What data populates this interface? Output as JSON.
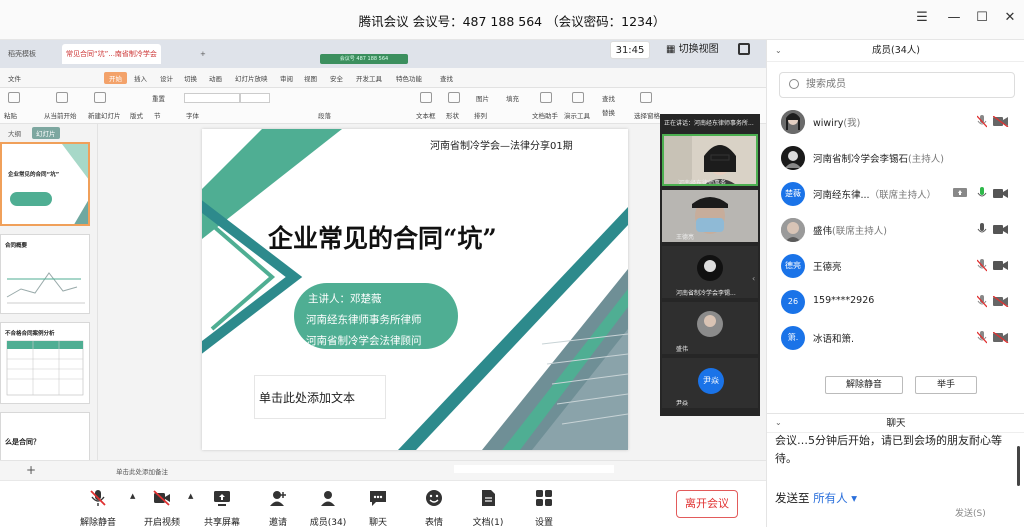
{
  "window": {
    "title_app": "腾讯会议",
    "meeting_id_label": "会议号：",
    "meeting_id": "487 188 564",
    "password_text": "（会议密码：1234）",
    "controls": [
      "☰",
      "—",
      "☐",
      "✕"
    ]
  },
  "share": {
    "timer": "31:45",
    "switch_view": "切换视图",
    "wps_tabs": [
      "稻壳模板",
      "常见合同“坑”...南省制冷学会"
    ],
    "meeting_caption": "会议号 487 188 564",
    "menu_items": [
      "文件",
      "开始",
      "插入",
      "设计",
      "切换",
      "动画",
      "幻灯片放映",
      "审阅",
      "视图",
      "安全",
      "开发工具",
      "特色功能",
      "查找"
    ],
    "menu_active": "开始",
    "ribbon_items": [
      "粘贴",
      "从当前开始",
      "新建幻灯片",
      "版式",
      "节",
      "重置",
      "字体",
      "段落",
      "文本框",
      "形状",
      "排列",
      "图片",
      "填充",
      "文档助手",
      "演示工具",
      "查找",
      "替换",
      "选择窗格"
    ],
    "thumb_tabs": [
      "大纲",
      "幻灯片"
    ],
    "thumbs": [
      {
        "title": "企业常见的合同“坑”"
      },
      {
        "title": "合同概要"
      },
      {
        "title": "不合格合同案例分析"
      },
      {
        "title": "么是合同？"
      }
    ],
    "status_note": "单击此处添加备注"
  },
  "slide": {
    "header": "河南省制冷学会—法律分享01期",
    "title": "企业常见的合同“坑”",
    "lines": [
      "主讲人：邓楚薇",
      "河南经东律师事务所律师",
      "河南省制冷学会法律顾问"
    ],
    "placeholder": "单击此处添加文本",
    "colors": {
      "teal": "#4fae93",
      "dark_teal": "#2d8a8c"
    }
  },
  "video_strip": {
    "speaking_label": "正在讲话：河南经东律师事务所...",
    "tiles": [
      {
        "name": "河南经东律师事务..."
      },
      {
        "name": "王德亮"
      },
      {
        "name": "河南省制冷学会李锡..."
      },
      {
        "name": "盛伟"
      },
      {
        "name": "尹焱",
        "avatar_text": "尹焱"
      }
    ]
  },
  "toolbar": {
    "buttons": [
      {
        "label": "解除静音",
        "icon": "mic-off-icon"
      },
      {
        "label": "开启视频",
        "icon": "video-off-icon"
      },
      {
        "label": "共享屏幕",
        "icon": "screen-share-icon"
      },
      {
        "label": "邀请",
        "icon": "invite-icon"
      },
      {
        "label": "成员(34)",
        "icon": "members-icon"
      },
      {
        "label": "聊天",
        "icon": "chat-icon"
      },
      {
        "label": "表情",
        "icon": "emoji-icon"
      },
      {
        "label": "文档(1)",
        "icon": "document-icon"
      },
      {
        "label": "设置",
        "icon": "settings-icon"
      }
    ],
    "leave": "离开会议"
  },
  "members": {
    "header": "成员(34人)",
    "search_placeholder": "搜索成员",
    "list": [
      {
        "name": "wiwiry",
        "role": "(我)",
        "avatar": "",
        "avatar_color": "#444444"
      },
      {
        "name": "河南省制冷学会李锡石",
        "role": "(主持人)",
        "avatar": "",
        "avatar_color": "#2b2b2b"
      },
      {
        "name": "河南经东律...",
        "role": "（联席主持人）",
        "avatar": "楚薇",
        "avatar_color": "#1a73e8"
      },
      {
        "name": "盛伟",
        "role": "(联席主持人)",
        "avatar": "",
        "avatar_color": "#8a8a8a"
      },
      {
        "name": "王德亮",
        "role": "",
        "avatar": "德亮",
        "avatar_color": "#1a73e8"
      },
      {
        "name": "159****2926",
        "role": "",
        "avatar": "26",
        "avatar_color": "#1a73e8"
      },
      {
        "name": "冰语和箫.",
        "role": "",
        "avatar": "箫.",
        "avatar_color": "#1a73e8"
      }
    ],
    "unmute_all": "解除静音",
    "raise_hand": "举手"
  },
  "chat": {
    "header": "聊天",
    "message": "会议…5分钟后开始，请已到会场的朋友耐心等待。",
    "send_to_label": "发送至",
    "send_to_target": "所有人",
    "send_button": "发送(S)"
  }
}
